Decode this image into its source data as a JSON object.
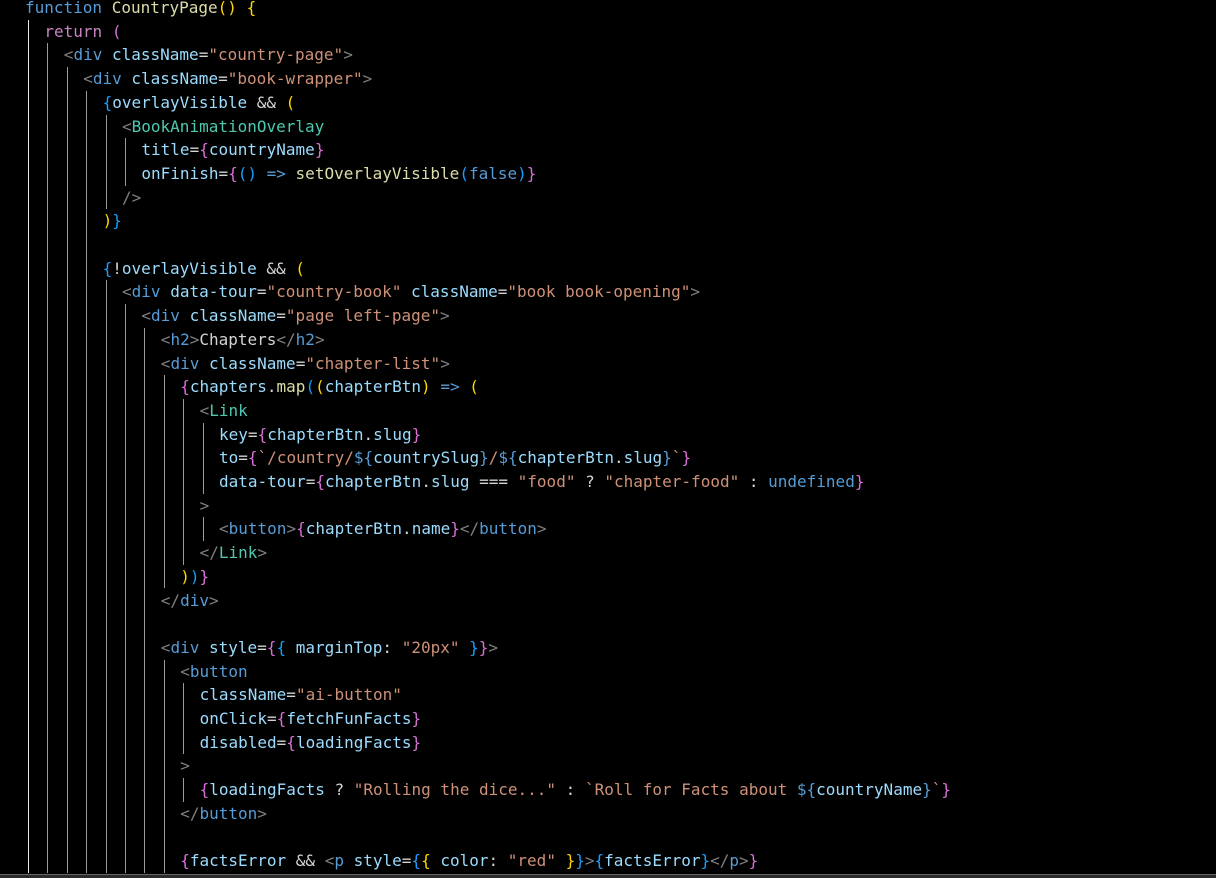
{
  "editor": {
    "language": "javascriptreact",
    "lines": [
      {
        "indent": 0,
        "tokens": [
          [
            "kw",
            "function"
          ],
          [
            "txt",
            " "
          ],
          [
            "fn",
            "CountryPage"
          ],
          [
            "b1",
            "()"
          ],
          [
            "txt",
            " "
          ],
          [
            "b1",
            "{"
          ]
        ]
      },
      {
        "indent": 1,
        "tokens": [
          [
            "ctl",
            "return"
          ],
          [
            "txt",
            " "
          ],
          [
            "b2",
            "("
          ]
        ]
      },
      {
        "indent": 2,
        "tokens": [
          [
            "punc",
            "<"
          ],
          [
            "tag",
            "div"
          ],
          [
            "txt",
            " "
          ],
          [
            "attr",
            "className"
          ],
          [
            "txt",
            "="
          ],
          [
            "str",
            "\"country-page\""
          ],
          [
            "punc",
            ">"
          ]
        ]
      },
      {
        "indent": 3,
        "tokens": [
          [
            "punc",
            "<"
          ],
          [
            "tag",
            "div"
          ],
          [
            "txt",
            " "
          ],
          [
            "attr",
            "className"
          ],
          [
            "txt",
            "="
          ],
          [
            "str",
            "\"book-wrapper\""
          ],
          [
            "punc",
            ">"
          ]
        ]
      },
      {
        "indent": 4,
        "tokens": [
          [
            "b3",
            "{"
          ],
          [
            "var",
            "overlayVisible"
          ],
          [
            "txt",
            " && "
          ],
          [
            "b1",
            "("
          ]
        ]
      },
      {
        "indent": 5,
        "tokens": [
          [
            "punc",
            "<"
          ],
          [
            "comp",
            "BookAnimationOverlay"
          ]
        ]
      },
      {
        "indent": 6,
        "tokens": [
          [
            "attr",
            "title"
          ],
          [
            "txt",
            "="
          ],
          [
            "b2",
            "{"
          ],
          [
            "var",
            "countryName"
          ],
          [
            "b2",
            "}"
          ]
        ]
      },
      {
        "indent": 6,
        "tokens": [
          [
            "attr",
            "onFinish"
          ],
          [
            "txt",
            "="
          ],
          [
            "b2",
            "{"
          ],
          [
            "b3",
            "()"
          ],
          [
            "txt",
            " "
          ],
          [
            "kw",
            "=>"
          ],
          [
            "txt",
            " "
          ],
          [
            "fn",
            "setOverlayVisible"
          ],
          [
            "b3",
            "("
          ],
          [
            "kw",
            "false"
          ],
          [
            "b3",
            ")"
          ],
          [
            "b2",
            "}"
          ]
        ]
      },
      {
        "indent": 5,
        "tokens": [
          [
            "punc",
            "/>"
          ]
        ]
      },
      {
        "indent": 4,
        "tokens": [
          [
            "b1",
            ")"
          ],
          [
            "b3",
            "}"
          ]
        ]
      },
      {
        "indent": 4,
        "tokens": []
      },
      {
        "indent": 4,
        "tokens": [
          [
            "b3",
            "{"
          ],
          [
            "txt",
            "!"
          ],
          [
            "var",
            "overlayVisible"
          ],
          [
            "txt",
            " && "
          ],
          [
            "b1",
            "("
          ]
        ]
      },
      {
        "indent": 5,
        "tokens": [
          [
            "punc",
            "<"
          ],
          [
            "tag",
            "div"
          ],
          [
            "txt",
            " "
          ],
          [
            "attr",
            "data-tour"
          ],
          [
            "txt",
            "="
          ],
          [
            "str",
            "\"country-book\""
          ],
          [
            "txt",
            " "
          ],
          [
            "attr",
            "className"
          ],
          [
            "txt",
            "="
          ],
          [
            "str",
            "\"book book-opening\""
          ],
          [
            "punc",
            ">"
          ]
        ]
      },
      {
        "indent": 6,
        "tokens": [
          [
            "punc",
            "<"
          ],
          [
            "tag",
            "div"
          ],
          [
            "txt",
            " "
          ],
          [
            "attr",
            "className"
          ],
          [
            "txt",
            "="
          ],
          [
            "str",
            "\"page left-page\""
          ],
          [
            "punc",
            ">"
          ]
        ]
      },
      {
        "indent": 7,
        "tokens": [
          [
            "punc",
            "<"
          ],
          [
            "tag",
            "h2"
          ],
          [
            "punc",
            ">"
          ],
          [
            "txt",
            "Chapters"
          ],
          [
            "punc",
            "</"
          ],
          [
            "tag",
            "h2"
          ],
          [
            "punc",
            ">"
          ]
        ]
      },
      {
        "indent": 7,
        "tokens": [
          [
            "punc",
            "<"
          ],
          [
            "tag",
            "div"
          ],
          [
            "txt",
            " "
          ],
          [
            "attr",
            "className"
          ],
          [
            "txt",
            "="
          ],
          [
            "str",
            "\"chapter-list\""
          ],
          [
            "punc",
            ">"
          ]
        ]
      },
      {
        "indent": 8,
        "tokens": [
          [
            "b2",
            "{"
          ],
          [
            "var",
            "chapters"
          ],
          [
            "txt",
            "."
          ],
          [
            "fn",
            "map"
          ],
          [
            "b3",
            "("
          ],
          [
            "b1",
            "("
          ],
          [
            "var",
            "chapterBtn"
          ],
          [
            "b1",
            ")"
          ],
          [
            "txt",
            " "
          ],
          [
            "kw",
            "=>"
          ],
          [
            "txt",
            " "
          ],
          [
            "b1",
            "("
          ]
        ]
      },
      {
        "indent": 9,
        "tokens": [
          [
            "punc",
            "<"
          ],
          [
            "comp",
            "Link"
          ]
        ]
      },
      {
        "indent": 10,
        "tokens": [
          [
            "attr",
            "key"
          ],
          [
            "txt",
            "="
          ],
          [
            "b2",
            "{"
          ],
          [
            "var",
            "chapterBtn"
          ],
          [
            "txt",
            "."
          ],
          [
            "var",
            "slug"
          ],
          [
            "b2",
            "}"
          ]
        ]
      },
      {
        "indent": 10,
        "tokens": [
          [
            "attr",
            "to"
          ],
          [
            "txt",
            "="
          ],
          [
            "b2",
            "{"
          ],
          [
            "str",
            "`/country/"
          ],
          [
            "kw",
            "${"
          ],
          [
            "var",
            "countrySlug"
          ],
          [
            "kw",
            "}"
          ],
          [
            "str",
            "/"
          ],
          [
            "kw",
            "${"
          ],
          [
            "var",
            "chapterBtn"
          ],
          [
            "txt",
            "."
          ],
          [
            "var",
            "slug"
          ],
          [
            "kw",
            "}"
          ],
          [
            "str",
            "`"
          ],
          [
            "b2",
            "}"
          ]
        ]
      },
      {
        "indent": 10,
        "tokens": [
          [
            "attr",
            "data-tour"
          ],
          [
            "txt",
            "="
          ],
          [
            "b2",
            "{"
          ],
          [
            "var",
            "chapterBtn"
          ],
          [
            "txt",
            "."
          ],
          [
            "var",
            "slug"
          ],
          [
            "txt",
            " === "
          ],
          [
            "str",
            "\"food\""
          ],
          [
            "txt",
            " ? "
          ],
          [
            "str",
            "\"chapter-food\""
          ],
          [
            "txt",
            " : "
          ],
          [
            "kw",
            "undefined"
          ],
          [
            "b2",
            "}"
          ]
        ]
      },
      {
        "indent": 9,
        "tokens": [
          [
            "punc",
            ">"
          ]
        ]
      },
      {
        "indent": 10,
        "tokens": [
          [
            "punc",
            "<"
          ],
          [
            "tag",
            "button"
          ],
          [
            "punc",
            ">"
          ],
          [
            "b2",
            "{"
          ],
          [
            "var",
            "chapterBtn"
          ],
          [
            "txt",
            "."
          ],
          [
            "var",
            "name"
          ],
          [
            "b2",
            "}"
          ],
          [
            "punc",
            "</"
          ],
          [
            "tag",
            "button"
          ],
          [
            "punc",
            ">"
          ]
        ]
      },
      {
        "indent": 9,
        "tokens": [
          [
            "punc",
            "</"
          ],
          [
            "comp",
            "Link"
          ],
          [
            "punc",
            ">"
          ]
        ]
      },
      {
        "indent": 8,
        "tokens": [
          [
            "b1",
            ")"
          ],
          [
            "b3",
            ")"
          ],
          [
            "b2",
            "}"
          ]
        ]
      },
      {
        "indent": 7,
        "tokens": [
          [
            "punc",
            "</"
          ],
          [
            "tag",
            "div"
          ],
          [
            "punc",
            ">"
          ]
        ]
      },
      {
        "indent": 7,
        "tokens": []
      },
      {
        "indent": 7,
        "tokens": [
          [
            "punc",
            "<"
          ],
          [
            "tag",
            "div"
          ],
          [
            "txt",
            " "
          ],
          [
            "attr",
            "style"
          ],
          [
            "txt",
            "="
          ],
          [
            "b2",
            "{"
          ],
          [
            "b3",
            "{"
          ],
          [
            "txt",
            " "
          ],
          [
            "var",
            "marginTop"
          ],
          [
            "txt",
            ": "
          ],
          [
            "str",
            "\"20px\""
          ],
          [
            "txt",
            " "
          ],
          [
            "b3",
            "}"
          ],
          [
            "b2",
            "}"
          ],
          [
            "punc",
            ">"
          ]
        ]
      },
      {
        "indent": 8,
        "tokens": [
          [
            "punc",
            "<"
          ],
          [
            "tag",
            "button"
          ]
        ]
      },
      {
        "indent": 9,
        "tokens": [
          [
            "attr",
            "className"
          ],
          [
            "txt",
            "="
          ],
          [
            "str",
            "\"ai-button\""
          ]
        ]
      },
      {
        "indent": 9,
        "tokens": [
          [
            "attr",
            "onClick"
          ],
          [
            "txt",
            "="
          ],
          [
            "b2",
            "{"
          ],
          [
            "var",
            "fetchFunFacts"
          ],
          [
            "b2",
            "}"
          ]
        ]
      },
      {
        "indent": 9,
        "tokens": [
          [
            "attr",
            "disabled"
          ],
          [
            "txt",
            "="
          ],
          [
            "b2",
            "{"
          ],
          [
            "var",
            "loadingFacts"
          ],
          [
            "b2",
            "}"
          ]
        ]
      },
      {
        "indent": 8,
        "tokens": [
          [
            "punc",
            ">"
          ]
        ]
      },
      {
        "indent": 9,
        "tokens": [
          [
            "b2",
            "{"
          ],
          [
            "var",
            "loadingFacts"
          ],
          [
            "txt",
            " ? "
          ],
          [
            "str",
            "\"Rolling the dice...\""
          ],
          [
            "txt",
            " : "
          ],
          [
            "str",
            "`Roll for Facts about "
          ],
          [
            "kw",
            "${"
          ],
          [
            "var",
            "countryName"
          ],
          [
            "kw",
            "}"
          ],
          [
            "str",
            "`"
          ],
          [
            "b2",
            "}"
          ]
        ]
      },
      {
        "indent": 8,
        "tokens": [
          [
            "punc",
            "</"
          ],
          [
            "tag",
            "button"
          ],
          [
            "punc",
            ">"
          ]
        ]
      },
      {
        "indent": 8,
        "tokens": []
      },
      {
        "indent": 8,
        "tokens": [
          [
            "b2",
            "{"
          ],
          [
            "var",
            "factsError"
          ],
          [
            "txt",
            " && "
          ],
          [
            "punc",
            "<"
          ],
          [
            "tag",
            "p"
          ],
          [
            "txt",
            " "
          ],
          [
            "attr",
            "style"
          ],
          [
            "txt",
            "="
          ],
          [
            "b3",
            "{"
          ],
          [
            "b1",
            "{"
          ],
          [
            "txt",
            " "
          ],
          [
            "var",
            "color"
          ],
          [
            "txt",
            ": "
          ],
          [
            "str",
            "\"red\""
          ],
          [
            "txt",
            " "
          ],
          [
            "b1",
            "}"
          ],
          [
            "b3",
            "}"
          ],
          [
            "punc",
            ">"
          ],
          [
            "b3",
            "{"
          ],
          [
            "var",
            "factsError"
          ],
          [
            "b3",
            "}"
          ],
          [
            "punc",
            "</"
          ],
          [
            "tag",
            "p"
          ],
          [
            "punc",
            ">"
          ],
          [
            "b2",
            "}"
          ]
        ]
      }
    ]
  }
}
